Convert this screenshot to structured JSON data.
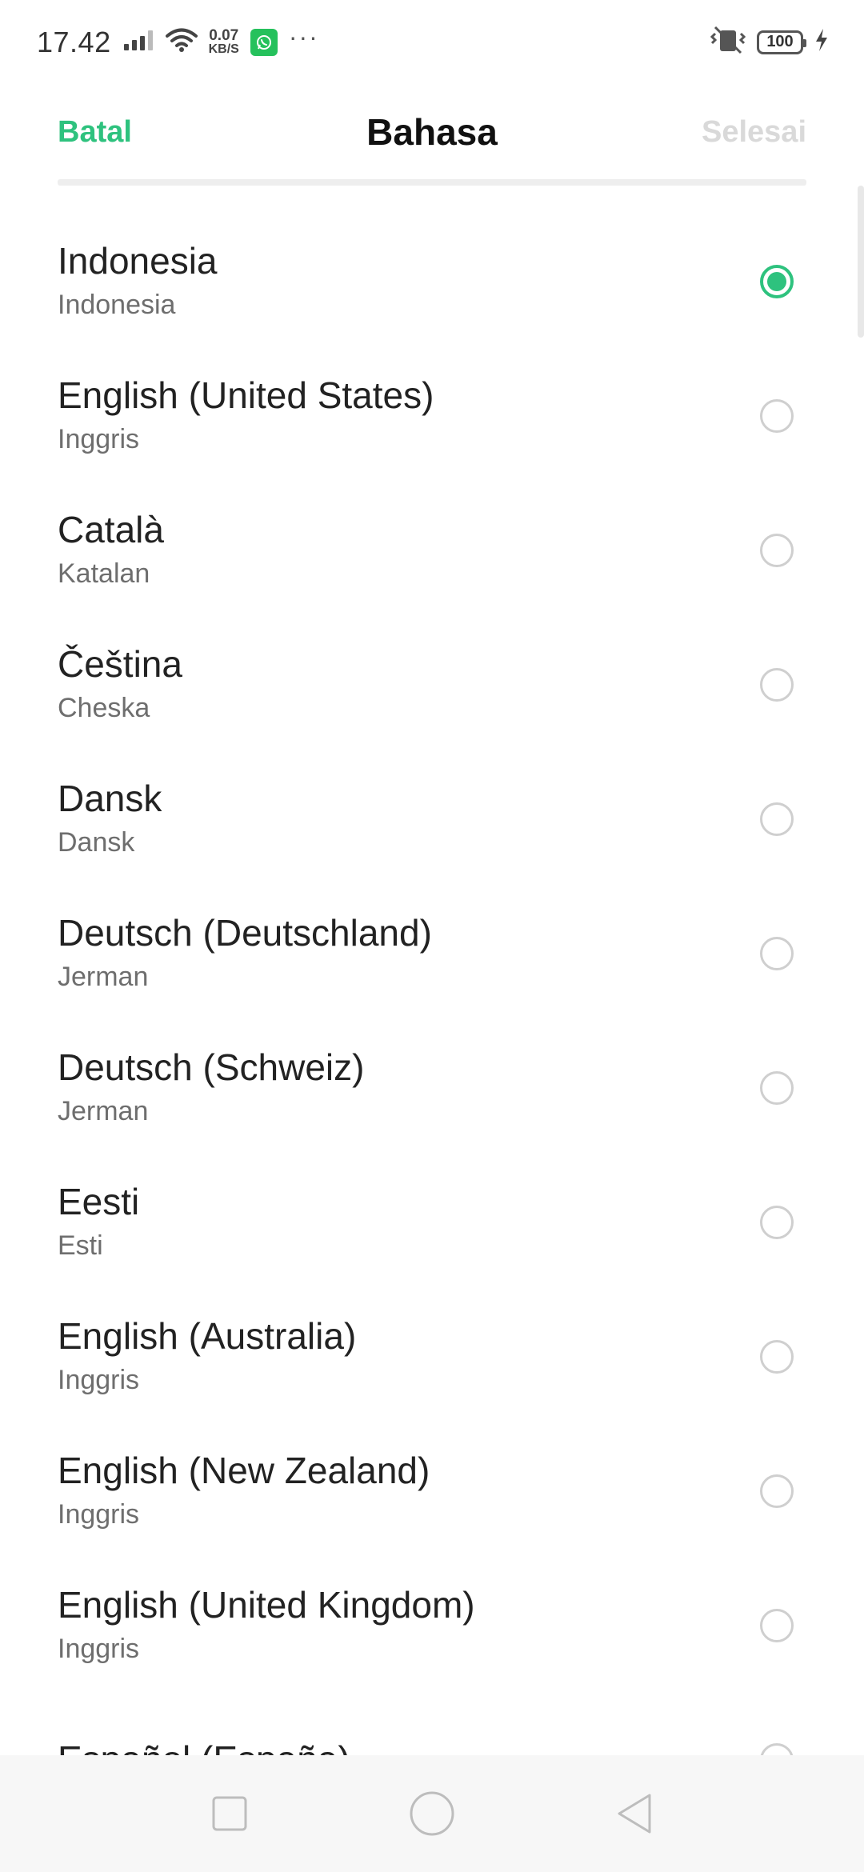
{
  "status_bar": {
    "time": "17.42",
    "speed_value": "0.07",
    "speed_unit": "KB/S",
    "more": "···",
    "battery": "100",
    "icons": [
      "signal-icon",
      "wifi-icon",
      "whatsapp-icon",
      "vibrate-off-icon",
      "battery-icon",
      "charging-icon"
    ]
  },
  "header": {
    "cancel_label": "Batal",
    "title": "Bahasa",
    "done_label": "Selesai"
  },
  "languages": [
    {
      "name": "Indonesia",
      "sub": "Indonesia",
      "selected": true
    },
    {
      "name": "English (United States)",
      "sub": "Inggris",
      "selected": false
    },
    {
      "name": "Català",
      "sub": "Katalan",
      "selected": false
    },
    {
      "name": "Čeština",
      "sub": "Cheska",
      "selected": false
    },
    {
      "name": "Dansk",
      "sub": "Dansk",
      "selected": false
    },
    {
      "name": "Deutsch (Deutschland)",
      "sub": "Jerman",
      "selected": false
    },
    {
      "name": "Deutsch (Schweiz)",
      "sub": "Jerman",
      "selected": false
    },
    {
      "name": "Eesti",
      "sub": "Esti",
      "selected": false
    },
    {
      "name": "English (Australia)",
      "sub": "Inggris",
      "selected": false
    },
    {
      "name": "English (New Zealand)",
      "sub": "Inggris",
      "selected": false
    },
    {
      "name": "English (United Kingdom)",
      "sub": "Inggris",
      "selected": false
    },
    {
      "name": "Español (España)",
      "sub": "",
      "selected": false
    }
  ],
  "colors": {
    "accent": "#2ec27e",
    "disabled": "#d9d9d9"
  },
  "nav": [
    "recents-square-icon",
    "home-circle-icon",
    "back-triangle-icon"
  ]
}
